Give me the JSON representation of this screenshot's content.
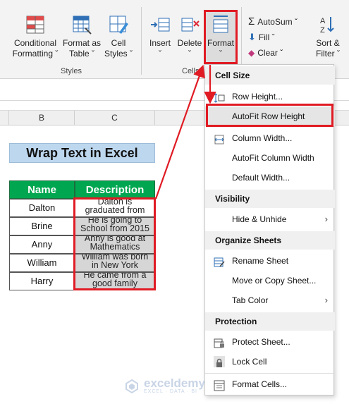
{
  "ribbon": {
    "styles_group": {
      "label": "Styles",
      "buttons": [
        {
          "line1": "Conditional",
          "line2": "Formatting ˇ"
        },
        {
          "line1": "Format as",
          "line2": "Table ˇ"
        },
        {
          "line1": "Cell",
          "line2": "Styles ˇ"
        }
      ]
    },
    "cells_group": {
      "label": "Cells",
      "buttons": [
        {
          "line1": "Insert",
          "line2": "ˇ"
        },
        {
          "line1": "Delete",
          "line2": "ˇ"
        },
        {
          "line1": "Format",
          "line2": "ˇ"
        }
      ]
    },
    "editing_group": {
      "autosum": "AutoSum ˇ",
      "fill": "Fill ˇ",
      "clear": "Clear ˇ",
      "sort_line1": "Sort &",
      "sort_line2": "Filter ˇ"
    }
  },
  "columns": [
    "B",
    "C"
  ],
  "sheet": {
    "title": "Wrap Text in Excel",
    "headers": [
      "Name",
      "Description"
    ],
    "rows": [
      {
        "name": "Dalton",
        "desc1": "Dalton is",
        "desc2": "graduated from"
      },
      {
        "name": "Brine",
        "desc1": "He is going to",
        "desc2": "School from 2015"
      },
      {
        "name": "Anny",
        "desc1": "Anny is good at",
        "desc2": "Mathematics"
      },
      {
        "name": "William",
        "desc1": "William was born",
        "desc2": "in New York"
      },
      {
        "name": "Harry",
        "desc1": "He came from a",
        "desc2": "good family"
      }
    ]
  },
  "menu": {
    "cell_size": "Cell Size",
    "row_height": "Row Height...",
    "autofit_row": "AutoFit Row Height",
    "column_width": "Column Width...",
    "autofit_col": "AutoFit Column Width",
    "default_width": "Default Width...",
    "visibility": "Visibility",
    "hide_unhide": "Hide & Unhide",
    "organize": "Organize Sheets",
    "rename": "Rename Sheet",
    "move_copy": "Move or Copy Sheet...",
    "tab_color": "Tab Color",
    "protection": "Protection",
    "protect_sheet": "Protect Sheet...",
    "lock_cell": "Lock Cell",
    "format_cells": "Format Cells..."
  },
  "watermark": {
    "name": "exceldemy",
    "tagline": "EXCEL · DATA · BI"
  },
  "colors": {
    "accent_red": "#e01b24",
    "table_header_green": "#00a650",
    "title_fill": "#bdd7ee"
  }
}
